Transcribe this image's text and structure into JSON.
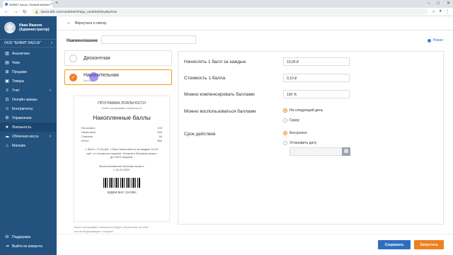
{
  "browser": {
    "tab_title": "БИФИТ Касса. Личный кабинет",
    "url": "kassa.bifit.com/cashdesk/#/app_cashdesk/loyalty/new"
  },
  "sidebar": {
    "user_name": "Иван Иванов",
    "user_role": "(Администратор)",
    "company": "ООО \"БИФИТ КАССА\"",
    "items": [
      {
        "label": "Аналитика",
        "icon": "chart-icon"
      },
      {
        "label": "Чеки",
        "icon": "receipt-icon"
      },
      {
        "label": "Продажи",
        "icon": "cart-icon"
      },
      {
        "label": "Товары",
        "icon": "box-icon"
      },
      {
        "label": "Учет",
        "icon": "list-icon"
      },
      {
        "label": "Онлайн-заказы",
        "icon": "cart-online-icon"
      },
      {
        "label": "Контрагенты",
        "icon": "users-icon"
      },
      {
        "label": "Управление",
        "icon": "gear-icon"
      },
      {
        "label": "Лояльность",
        "icon": "star-icon"
      },
      {
        "label": "Облачная касса",
        "icon": "cloud-icon"
      },
      {
        "label": "Магазин",
        "icon": "store-icon"
      }
    ],
    "support": "Поддержка",
    "logout": "Выйти из аккаунта"
  },
  "header": {
    "back_label": "Вернуться к списку"
  },
  "form": {
    "name_label": "Наименование",
    "new_label": "Новая",
    "types": [
      {
        "label": "Дисконтная",
        "sub": ""
      },
      {
        "label": "Накопительная",
        "sub": "Выбран"
      }
    ]
  },
  "receipt": {
    "title": "ПРОГРАММА ЛОЯЛЬНОСТИ",
    "subtitle": "Билет программы лояльности",
    "heading": "Накопленные баллы",
    "rows": [
      {
        "label": "На начало",
        "value": "100"
      },
      {
        "label": "Начислено",
        "value": "500"
      },
      {
        "label": "Списано",
        "value": "50"
      },
      {
        "label": "Итого",
        "value": "550"
      }
    ],
    "note_line1": "1 балл = 0,10 руб. 1 балл начисляется за каждые 10,00",
    "note_line2": "руб. от стоимости покупки. Оплатить баллами можно",
    "note_line3": "до 100% покупки.",
    "spend_line1": "Воспользоваться баллами можно:",
    "spend_line2": "с 31.03.2020",
    "thanks": "ЖДЕМ ВАС СНОВА",
    "footer_line1": "Билет программы лояльности будет распечатан на чеке",
    "footer_line2": "после информации о покупке."
  },
  "settings": {
    "accrue_label": "Начислять 1 балл за каждые",
    "accrue_value": "10,00 ₽",
    "cost_label": "Стоимость 1 балла",
    "cost_value": "0,10 ₽",
    "compensate_label": "Можно компенсировать баллами",
    "compensate_value": "100 %",
    "use_label": "Можно воспользоваться баллами",
    "use_options": [
      "На следующий день",
      "Сразу"
    ],
    "validity_label": "Срок действия",
    "validity_options": [
      "Бессрочно",
      "Установить дату"
    ]
  },
  "actions": {
    "save": "Сохранить",
    "run": "Запустить"
  },
  "colors": {
    "sidebar": "#23527f",
    "accent": "#f07f1f",
    "primary_button": "#2f6fbf"
  }
}
